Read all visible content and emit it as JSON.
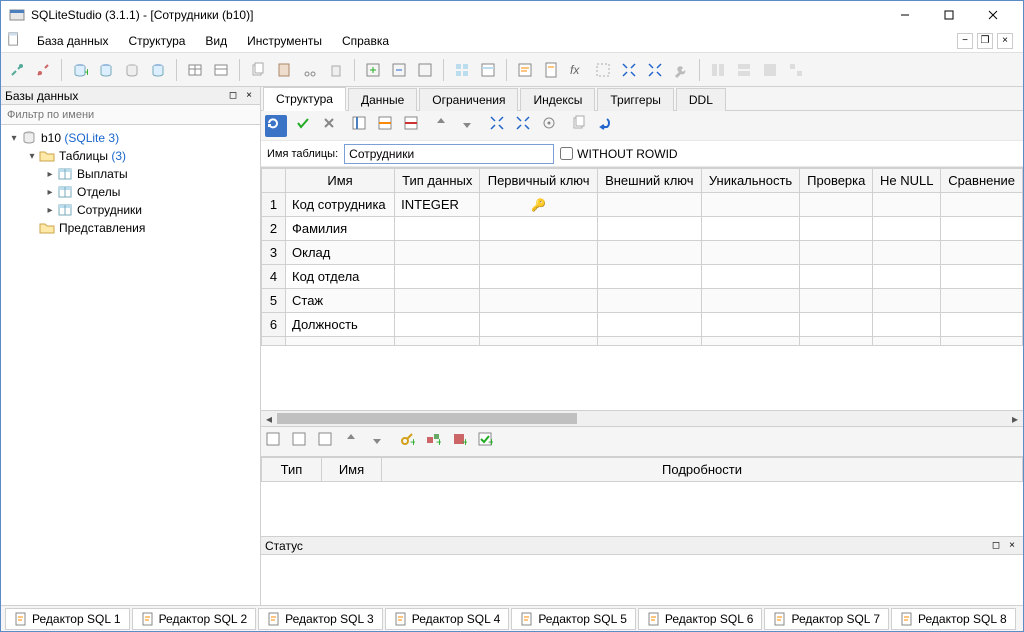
{
  "window": {
    "title": "SQLiteStudio (3.1.1) - [Сотрудники (b10)]"
  },
  "menu": [
    "База данных",
    "Структура",
    "Вид",
    "Инструменты",
    "Справка"
  ],
  "leftPanel": {
    "title": "Базы данных",
    "filterPlaceholder": "Фильтр по имени",
    "db": "b10",
    "dbType": "(SQLite 3)",
    "tablesLabel": "Таблицы",
    "tablesCount": "(3)",
    "tables": [
      "Выплаты",
      "Отделы",
      "Сотрудники"
    ],
    "viewsLabel": "Представления"
  },
  "tabs": [
    "Структура",
    "Данные",
    "Ограничения",
    "Индексы",
    "Триггеры",
    "DDL"
  ],
  "activeTab": 0,
  "tableNameLabel": "Имя таблицы:",
  "tableName": "Сотрудники",
  "withoutRowid": "WITHOUT ROWID",
  "columnsHeader": [
    "Имя",
    "Тип данных",
    "Первичный ключ",
    "Внешний ключ",
    "Уникальность",
    "Проверка",
    "Не NULL",
    "Сравнение"
  ],
  "columns": [
    {
      "n": "1",
      "name": "Код сотрудника",
      "type": "INTEGER",
      "pk": true
    },
    {
      "n": "2",
      "name": "Фамилия",
      "type": "",
      "pk": false
    },
    {
      "n": "3",
      "name": "Оклад",
      "type": "",
      "pk": false
    },
    {
      "n": "4",
      "name": "Код отдела",
      "type": "",
      "pk": false
    },
    {
      "n": "5",
      "name": "Стаж",
      "type": "",
      "pk": false
    },
    {
      "n": "6",
      "name": "Должность",
      "type": "",
      "pk": false
    }
  ],
  "constraintsHeader": [
    "Тип",
    "Имя",
    "Подробности"
  ],
  "statusTitle": "Статус",
  "editors": [
    "Редактор SQL 1",
    "Редактор SQL 2",
    "Редактор SQL 3",
    "Редактор SQL 4",
    "Редактор SQL 5",
    "Редактор SQL 6",
    "Редактор SQL 7",
    "Редактор SQL 8"
  ]
}
